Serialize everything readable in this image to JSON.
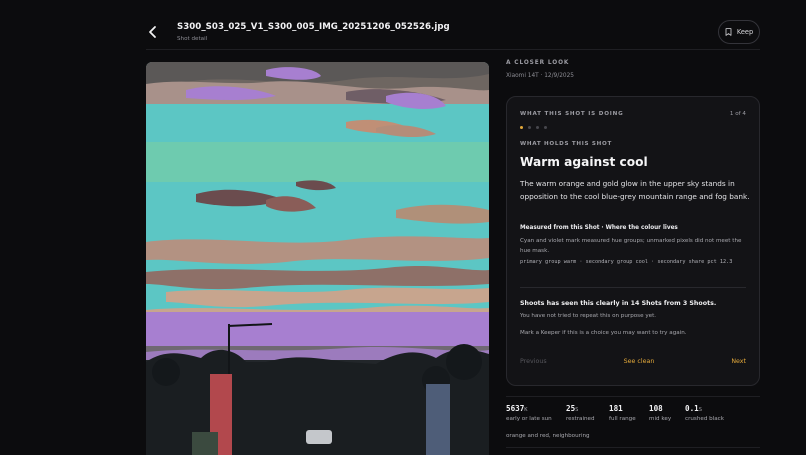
{
  "header": {
    "back_icon": "chevron-left-icon",
    "title": "S300_S03_025_V1_S300_005_IMG_20251206_052526.jpg",
    "subtitle": "Shot detail",
    "keep_label": "Keep",
    "keep_icon": "bookmark-icon"
  },
  "photo": {
    "description_icon": "photo",
    "colors": {
      "cyan": "#5ac8c6",
      "violet": "#a77fd0",
      "warm": "#b69a83",
      "dark": "#202225"
    }
  },
  "side": {
    "eyebrow": "A CLOSER LOOK",
    "meta": "Xiaomi 14T · 12/9/2025"
  },
  "card": {
    "label": "WHAT THIS SHOT IS DOING",
    "counter": "1 of 4",
    "dots": 4,
    "active_dot": 0,
    "holds_label": "WHAT HOLDS THIS SHOT",
    "headline": "Warm against cool",
    "body": "The warm orange and gold glow in the upper sky stands in opposition to the cool blue-grey mountain range and fog bank.",
    "measured_title": "Measured from this Shot · Where the colour lives",
    "measured_explain": "Cyan and violet mark measured hue groups; unmarked pixels did not meet the hue mask.",
    "measured_mono": "primary group warm · secondary group cool · secondary share pct 12.3",
    "seen": "Shoots has seen this clearly in 14 Shots from 3 Shoots.",
    "note1": "You have not tried to repeat this on purpose yet.",
    "note2": "Mark a Keeper if this is a choice you may want to try again.",
    "prev": "Previous",
    "see_clean": "See clean",
    "next": "Next",
    "accent": "#e2a83a"
  },
  "stats": [
    {
      "value": "5637",
      "unit": "K",
      "label": "early or late sun"
    },
    {
      "value": "25",
      "unit": "S",
      "label": "restrained"
    },
    {
      "value": "181",
      "unit": "",
      "label": "full range"
    },
    {
      "value": "108",
      "unit": "",
      "label": "mid key"
    },
    {
      "value": "0.1",
      "unit": "S",
      "label": "crushed black"
    }
  ],
  "stats_extra": "orange and red, neighbouring"
}
